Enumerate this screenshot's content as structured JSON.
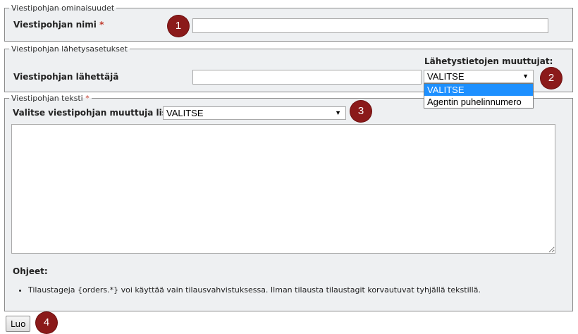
{
  "section1": {
    "legend": "Viestipohjan ominaisuudet",
    "name_label": "Viestipohjan nimi",
    "required_mark": "*",
    "name_value": ""
  },
  "section2": {
    "legend": "Viestipohjan lähetysasetukset",
    "sender_label": "Viestipohjan lähettäjä",
    "sender_value": "",
    "variables_label": "Lähetystietojen muuttujat:",
    "select_value": "VALITSE",
    "options": [
      "VALITSE",
      "Agentin puhelinnumero"
    ]
  },
  "section3": {
    "legend": "Viestipohjan teksti",
    "required_mark": "*",
    "var_label": "Valitse viestipohjan muuttuja listalta:",
    "select_value": "VALITSE",
    "text_value": "",
    "help_title": "Ohjeet:",
    "help_items": [
      "Tilaustageja {orders.*} voi käyttää vain tilausvahvistuksessa. Ilman tilausta tilaustagit korvautuvat tyhjällä tekstillä."
    ]
  },
  "submit": {
    "label": "Luo"
  },
  "badges": [
    "1",
    "2",
    "3",
    "4"
  ],
  "colors": {
    "badge": "#8b1a1a",
    "selected_option": "#1e90ff",
    "required": "#c0392b"
  },
  "icons": {
    "select_arrow": "▼"
  }
}
